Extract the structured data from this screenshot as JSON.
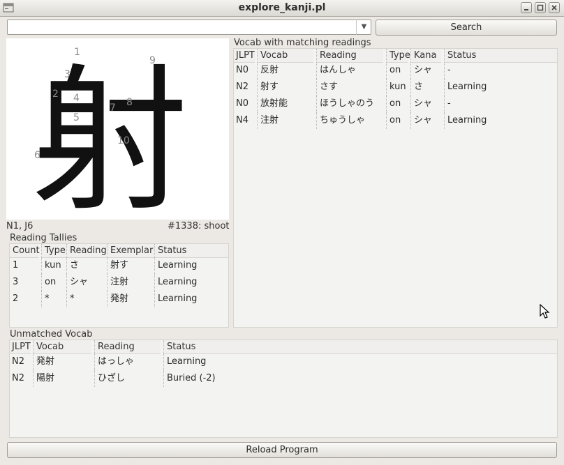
{
  "window": {
    "title": "explore_kanji.pl"
  },
  "search": {
    "value": "",
    "button_label": "Search"
  },
  "kanji": {
    "character": "射",
    "stroke_numbers": [
      "1",
      "2",
      "3",
      "4",
      "5",
      "6",
      "7",
      "8",
      "9",
      "10"
    ],
    "grade_info": "N1, J6",
    "id_meaning": "#1338: shoot"
  },
  "reading_tallies": {
    "title": "Reading Tallies",
    "columns": [
      "Count",
      "Type",
      "Reading",
      "Exemplar",
      "Status"
    ],
    "rows": [
      [
        "1",
        "kun",
        "さ",
        "射す",
        "Learning"
      ],
      [
        "3",
        "on",
        "シャ",
        "注射",
        "Learning"
      ],
      [
        "2",
        "*",
        "*",
        "発射",
        "Learning"
      ]
    ]
  },
  "vocab_matching": {
    "title": "Vocab with matching readings",
    "columns": [
      "JLPT",
      "Vocab",
      "Reading",
      "Type",
      "Kana",
      "Status"
    ],
    "rows": [
      [
        "N0",
        "反射",
        "はんしゃ",
        "on",
        "シャ",
        "-"
      ],
      [
        "N2",
        "射す",
        "さす",
        "kun",
        "さ",
        "Learning"
      ],
      [
        "N0",
        "放射能",
        "ほうしゃのう",
        "on",
        "シャ",
        "-"
      ],
      [
        "N4",
        "注射",
        "ちゅうしゃ",
        "on",
        "シャ",
        "Learning"
      ]
    ]
  },
  "unmatched_vocab": {
    "title": "Unmatched Vocab",
    "columns": [
      "JLPT",
      "Vocab",
      "Reading",
      "Status"
    ],
    "rows": [
      [
        "N2",
        "発射",
        "はっしゃ",
        "Learning"
      ],
      [
        "N2",
        "陽射",
        "ひざし",
        "Buried (-2)"
      ]
    ]
  },
  "footer": {
    "reload_label": "Reload Program"
  }
}
